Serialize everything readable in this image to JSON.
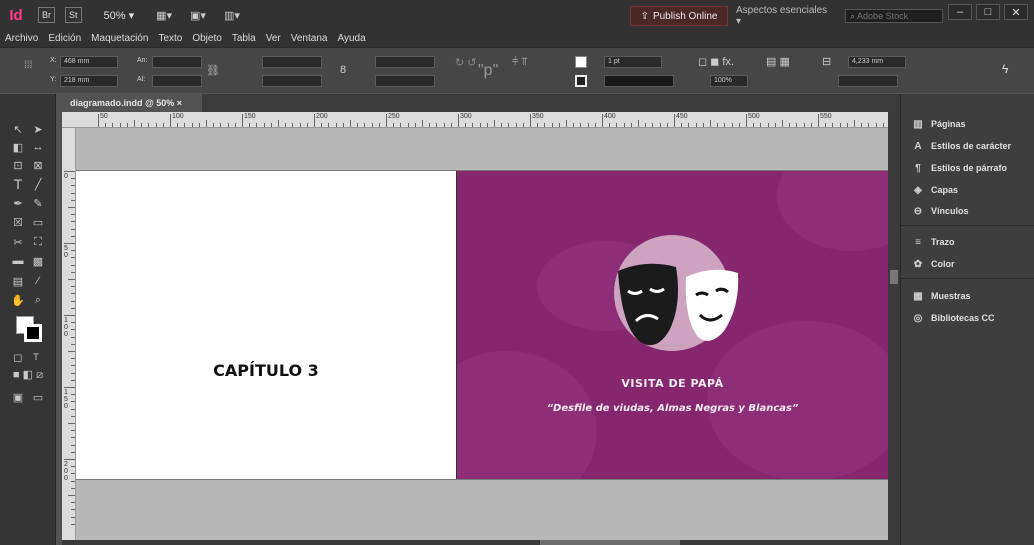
{
  "app": {
    "logo": "Id",
    "bridge_badge": "Br",
    "stock_badge": "St",
    "zoom": "50% ▾",
    "publish_label": "Publish Online",
    "workspace_label": "Aspectos esenciales ▾",
    "stock_search_placeholder": "Adobe Stock",
    "window_buttons": [
      "–",
      "□",
      "✕"
    ]
  },
  "menu": [
    "Archivo",
    "Edición",
    "Maquetación",
    "Texto",
    "Objeto",
    "Tabla",
    "Ver",
    "Ventana",
    "Ayuda"
  ],
  "control": {
    "x_label": "X:",
    "x_value": "468 mm",
    "y_label": "Y:",
    "y_value": "218 mm",
    "w_label": "An:",
    "h_label": "Al:",
    "stroke_weight": "1 pt",
    "opacity": "100%",
    "dimension": "4,233 mm"
  },
  "document": {
    "tab_title": "diagramado.indd @ 50% ×"
  },
  "ruler": {
    "h_labels": [
      "50",
      "100",
      "150",
      "200",
      "250",
      "300",
      "350",
      "400",
      "450",
      "500",
      "550"
    ],
    "v_labels": [
      "0",
      "5 0",
      "1 0 0",
      "1 5 0",
      "2 0 0"
    ]
  },
  "page_left": {
    "chapter_title": "CAPÍTULO 3"
  },
  "page_right": {
    "title": "VISITA DE PAPÁ",
    "subtitle": "“Desfile de viudas, Almas Negras y Blancas”",
    "colors": {
      "background": "#86276e",
      "circle": "#cda3c0"
    }
  },
  "panel": {
    "items": [
      {
        "label": "Páginas",
        "icon": "pages-icon"
      },
      {
        "label": "Estilos de carácter",
        "icon": "character-styles-icon"
      },
      {
        "label": "Estilos de párrafo",
        "icon": "paragraph-styles-icon"
      },
      {
        "label": "Capas",
        "icon": "layers-icon"
      },
      {
        "label": "Vínculos",
        "icon": "links-icon"
      },
      {
        "label": "Trazo",
        "icon": "stroke-icon"
      },
      {
        "label": "Color",
        "icon": "color-icon"
      },
      {
        "label": "Muestras",
        "icon": "swatches-icon"
      },
      {
        "label": "Bibliotecas CC",
        "icon": "cc-libraries-icon"
      }
    ]
  }
}
